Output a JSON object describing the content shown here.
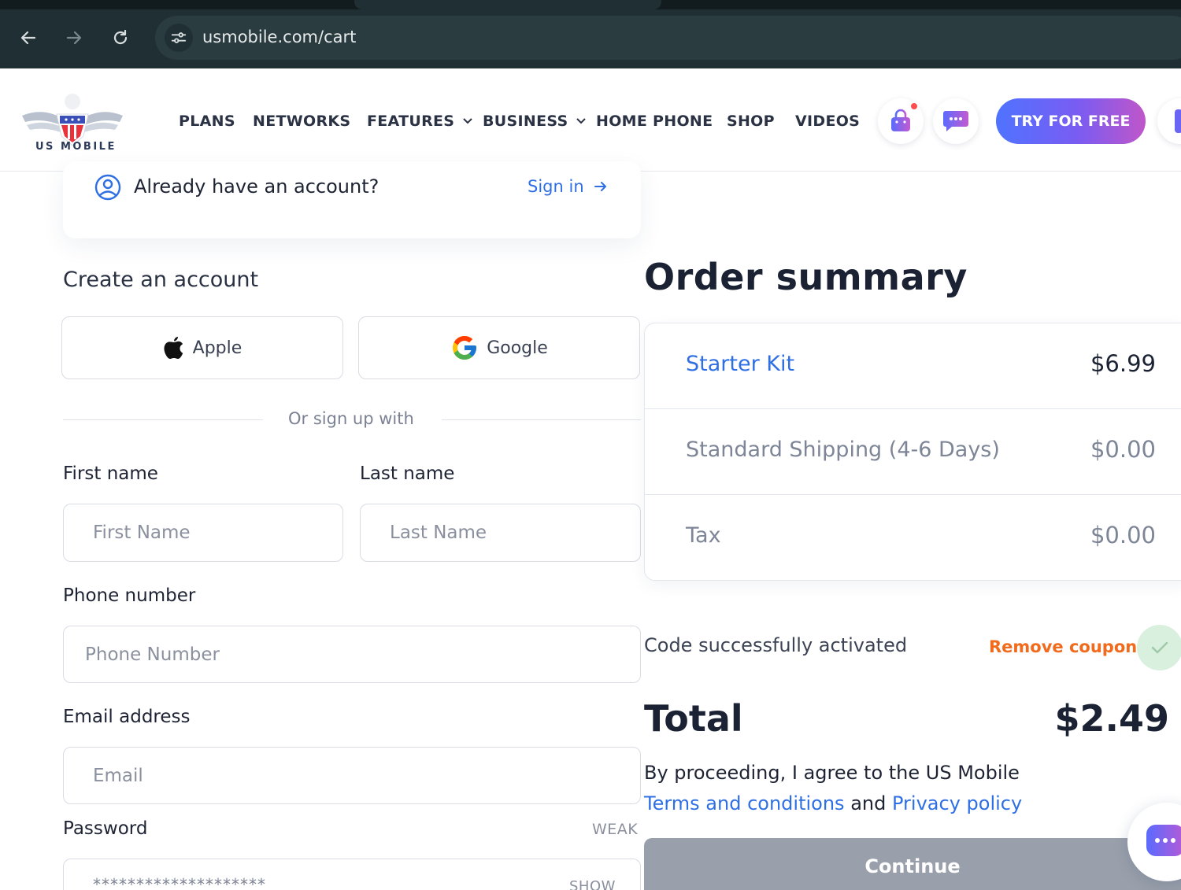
{
  "browser": {
    "url": "usmobile.com/cart"
  },
  "header": {
    "logo_text": "US MOBILE",
    "nav": [
      {
        "label": "PLANS",
        "dropdown": false
      },
      {
        "label": "NETWORKS",
        "dropdown": false
      },
      {
        "label": "FEATURES",
        "dropdown": true
      },
      {
        "label": "BUSINESS",
        "dropdown": true
      },
      {
        "label": "HOME PHONE",
        "dropdown": false
      },
      {
        "label": "SHOP",
        "dropdown": false
      },
      {
        "label": "VIDEOS",
        "dropdown": false
      }
    ],
    "try_button": "TRY FOR FREE"
  },
  "signin": {
    "question": "Already have an account?",
    "link": "Sign in"
  },
  "create_account": {
    "title": "Create an account",
    "apple_label": "Apple",
    "google_label": "Google",
    "divider_text": "Or sign up with",
    "first_name_label": "First name",
    "first_name_placeholder": "First Name",
    "last_name_label": "Last name",
    "last_name_placeholder": "Last Name",
    "phone_label": "Phone number",
    "phone_placeholder": "Phone Number",
    "email_label": "Email address",
    "email_placeholder": "Email",
    "password_label": "Password",
    "password_strength": "WEAK",
    "password_mask": "********************",
    "password_show": "SHOW"
  },
  "order": {
    "title": "Order summary",
    "items": [
      {
        "label": "Starter Kit",
        "value": "$6.99"
      },
      {
        "label": "Standard Shipping (4-6 Days)",
        "value": "$0.00"
      },
      {
        "label": "Tax",
        "value": "$0.00"
      }
    ],
    "coupon_status": "Code successfully activated",
    "remove_coupon": "Remove coupon",
    "total_label": "Total",
    "total_value": "$2.49",
    "agree_prefix": "By proceeding, I agree to the US Mobile",
    "terms_link": "Terms and conditions",
    "agree_and": "and",
    "privacy_link": "Privacy policy",
    "continue_label": "Continue"
  },
  "colors": {
    "accent_blue": "#2f6fe4",
    "coupon_orange": "#f26a1b",
    "chrome_dark": "#1f2f33",
    "disabled_button": "#9aa0ab"
  },
  "icons": [
    "back-arrow-icon",
    "forward-arrow-icon",
    "reload-icon",
    "site-info-icon",
    "cart-icon",
    "chat-icon",
    "user-circle-icon",
    "arrow-right-icon",
    "apple-icon",
    "google-icon",
    "chevron-down-icon",
    "check-icon"
  ]
}
